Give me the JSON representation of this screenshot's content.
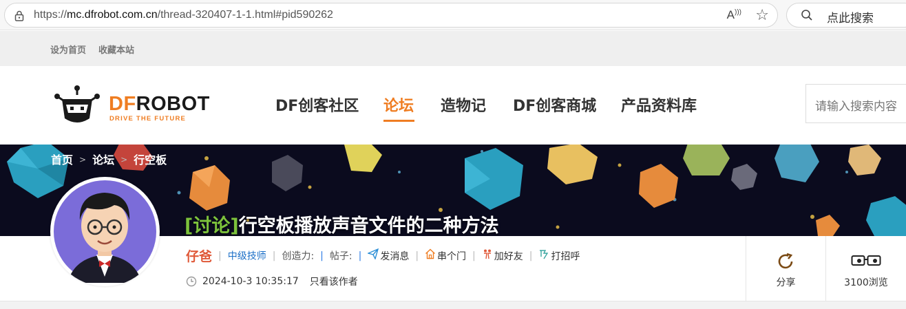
{
  "browser": {
    "url_prefix": "https://",
    "url_host": "mc.dfrobot.com.cn",
    "url_path": "/thread-320407-1-1.html#pid590262",
    "read_aloud_icon": "read-aloud-icon",
    "favorite_icon": "star-icon",
    "search_placeholder": "点此搜索"
  },
  "top_strip": {
    "set_home": "设为首页",
    "bookmark": "收藏本站"
  },
  "header": {
    "logo_df": "DF",
    "logo_robot": "ROBOT",
    "logo_tagline": "DRIVE THE FUTURE",
    "nav": [
      {
        "label": "DF创客社区",
        "active": false
      },
      {
        "label": "论坛",
        "active": true
      },
      {
        "label": "造物记",
        "active": false
      },
      {
        "label": "DF创客商城",
        "active": false
      },
      {
        "label": "产品资料库",
        "active": false
      }
    ],
    "search_placeholder": "请输入搜索内容"
  },
  "breadcrumb": {
    "items": [
      "首页",
      "论坛",
      "行空板"
    ],
    "separator": ">"
  },
  "thread": {
    "tag": "[讨论]",
    "title": "行空板播放声音文件的二种方法"
  },
  "author": {
    "name": "仔爸",
    "level": "中级技师",
    "creativity_label": "创造力:",
    "posts_label": "帖子:",
    "send_message": "发消息",
    "visit_home": "串个门",
    "add_friend": "加好友",
    "greet": "打招呼",
    "post_time": "2024-10-3 10:35:17",
    "only_author": "只看该作者"
  },
  "side": {
    "share_label": "分享",
    "views_label": "3100浏览"
  },
  "colors": {
    "accent": "#ef7d22",
    "author_name": "#e05a3a",
    "level_blue": "#1b6fc7",
    "tag_green": "#7dc33c"
  }
}
